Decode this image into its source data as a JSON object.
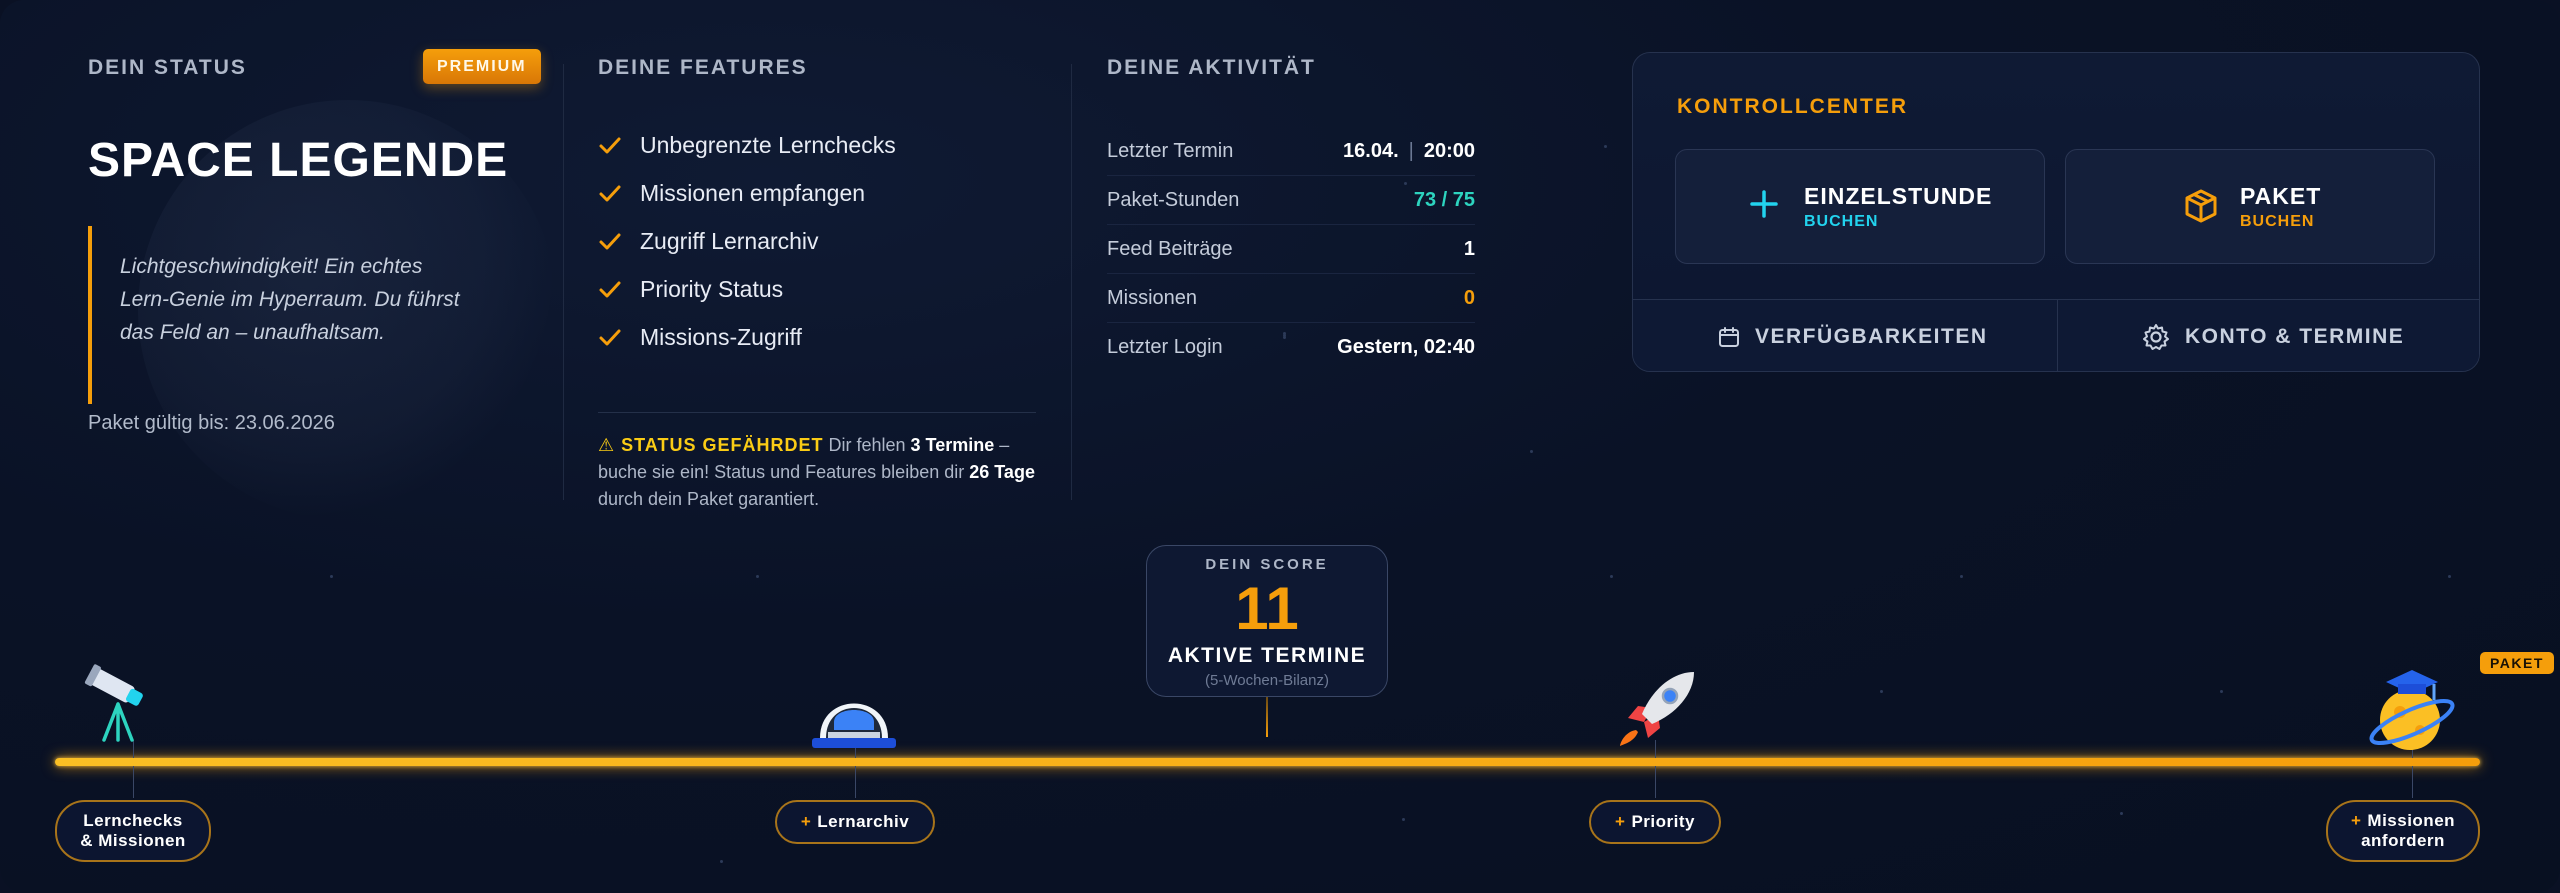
{
  "status": {
    "section_title": "DEIN STATUS",
    "badge": "PREMIUM",
    "title": "SPACE LEGENDE",
    "quote_line1": "Lichtgeschwindigkeit! Ein echtes",
    "quote_line2": "Lern-Genie im Hyperraum. Du führst",
    "quote_line3": "das Feld an – unaufhaltsam.",
    "valid_until": "Paket gültig bis: 23.06.2026"
  },
  "features": {
    "section_title": "DEINE FEATURES",
    "items": [
      "Unbegrenzte Lernchecks",
      "Missionen empfangen",
      "Zugriff Lernarchiv",
      "Priority Status",
      "Missions-Zugriff"
    ],
    "warning": {
      "head": "⚠ STATUS GEFÄHRDET",
      "t1": "Dir fehlen",
      "b1": "3 Termine",
      "t2": "– buche sie ein! Status und Features bleiben dir",
      "b2": "26 Tage",
      "t3": "durch dein Paket garantiert."
    }
  },
  "activity": {
    "section_title": "DEINE AKTIVITÄT",
    "rows": [
      {
        "label": "Letzter Termin",
        "date": "16.04.",
        "sep": "|",
        "time": "20:00"
      },
      {
        "label": "Paket-Stunden",
        "value": "73 / 75"
      },
      {
        "label": "Feed Beiträge",
        "value": "1"
      },
      {
        "label": "Missionen",
        "value": "0"
      },
      {
        "label": "Letzter Login",
        "value": "Gestern, 02:40"
      }
    ]
  },
  "control_center": {
    "title": "KONTROLLCENTER",
    "btn_single": {
      "title": "EINZELSTUNDE",
      "sub": "BUCHEN",
      "icon": "plus-icon",
      "color": "#22d3ee"
    },
    "btn_package": {
      "title": "PAKET",
      "sub": "BUCHEN",
      "icon": "box-icon",
      "color": "#f59e0b"
    },
    "link_availability": "VERFÜGBARKEITEN",
    "link_account": "KONTO & TERMINE"
  },
  "score": {
    "label": "DEIN SCORE",
    "value": "11",
    "subtitle": "AKTIVE TERMINE",
    "hint": "(5-Wochen-Bilanz)"
  },
  "timeline": {
    "m1_line1": "Lernchecks",
    "m1_line2": "& Missionen",
    "m2": "Lernarchiv",
    "m3": "Priority",
    "m4_line1": "Missionen",
    "m4_line2": "anfordern",
    "plus": "+",
    "paket_tag": "PAKET"
  },
  "colors": {
    "accent": "#f59e0b",
    "teal": "#2dd4bf",
    "warning": "#facc15"
  }
}
